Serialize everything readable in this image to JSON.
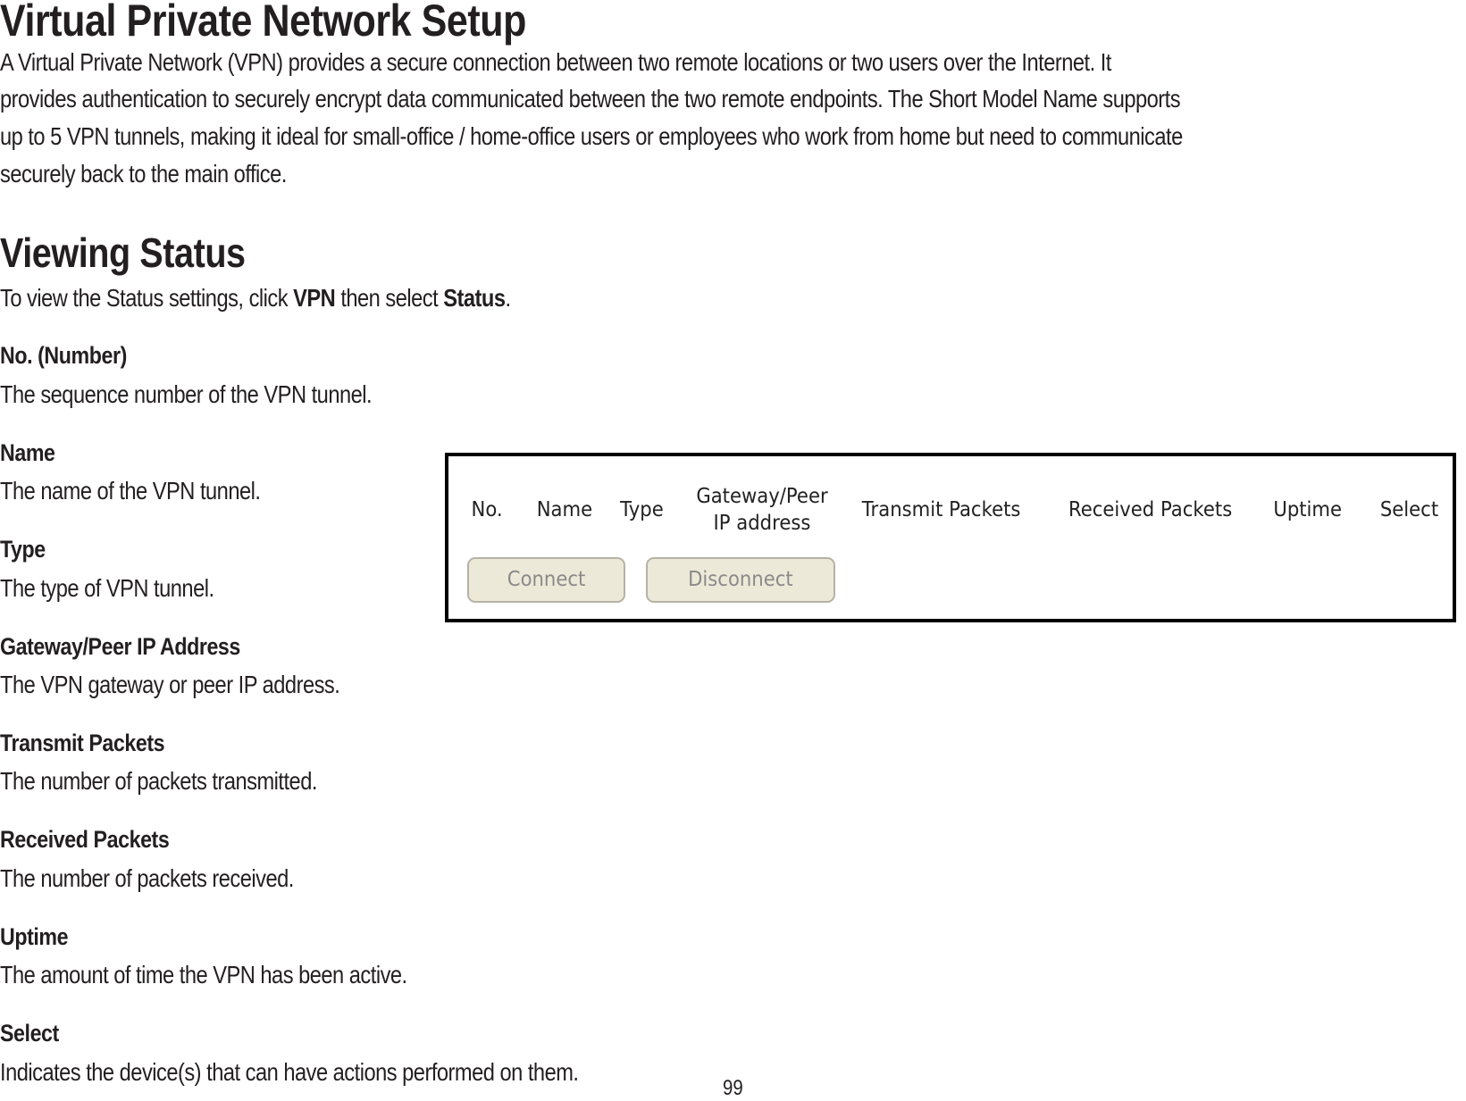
{
  "heading": "Virtual Private Network Setup",
  "intro_lines": [
    "A Virtual Private Network (VPN) provides a secure connection between two remote locations or two users over the Internet. It",
    "provides authentication to securely encrypt data communicated between the two remote endpoints. The Short Model Name supports",
    "up to 5 VPN tunnels, making it ideal for small-office / home-office  users or employees who work from home but need to communicate",
    "securely back to the main office."
  ],
  "section": {
    "title": "Viewing Status",
    "instruction": {
      "prefix": "To view the Status settings, click ",
      "menu": "VPN",
      "middle": " then select ",
      "item": "Status",
      "suffix": "."
    }
  },
  "definitions": [
    {
      "term": "No. (Number)",
      "description": "The sequence number of the VPN tunnel."
    },
    {
      "term": "Name",
      "description": "The name of the VPN tunnel."
    },
    {
      "term": "Type",
      "description": "The type of VPN tunnel."
    },
    {
      "term": "Gateway/Peer IP Address",
      "description": "The VPN gateway or peer IP address."
    },
    {
      "term": "Transmit Packets",
      "description": "The number of packets transmitted."
    },
    {
      "term": "Received Packets",
      "description": "The number of packets received."
    },
    {
      "term": "Uptime",
      "description": "The amount of time the VPN has been active."
    },
    {
      "term": "Select",
      "description": "Indicates the device(s) that can have actions performed on them."
    }
  ],
  "status_panel": {
    "columns": [
      {
        "line1": "No.",
        "line2": ""
      },
      {
        "line1": "Name",
        "line2": ""
      },
      {
        "line1": "Type",
        "line2": ""
      },
      {
        "line1": "Gateway/Peer",
        "line2": "IP address"
      },
      {
        "line1": "Transmit Packets",
        "line2": ""
      },
      {
        "line1": "Received Packets",
        "line2": ""
      },
      {
        "line1": "Uptime",
        "line2": ""
      },
      {
        "line1": "Select",
        "line2": ""
      }
    ],
    "buttons": {
      "connect": "Connect",
      "disconnect": "Disconnect"
    }
  },
  "page_number": "99"
}
